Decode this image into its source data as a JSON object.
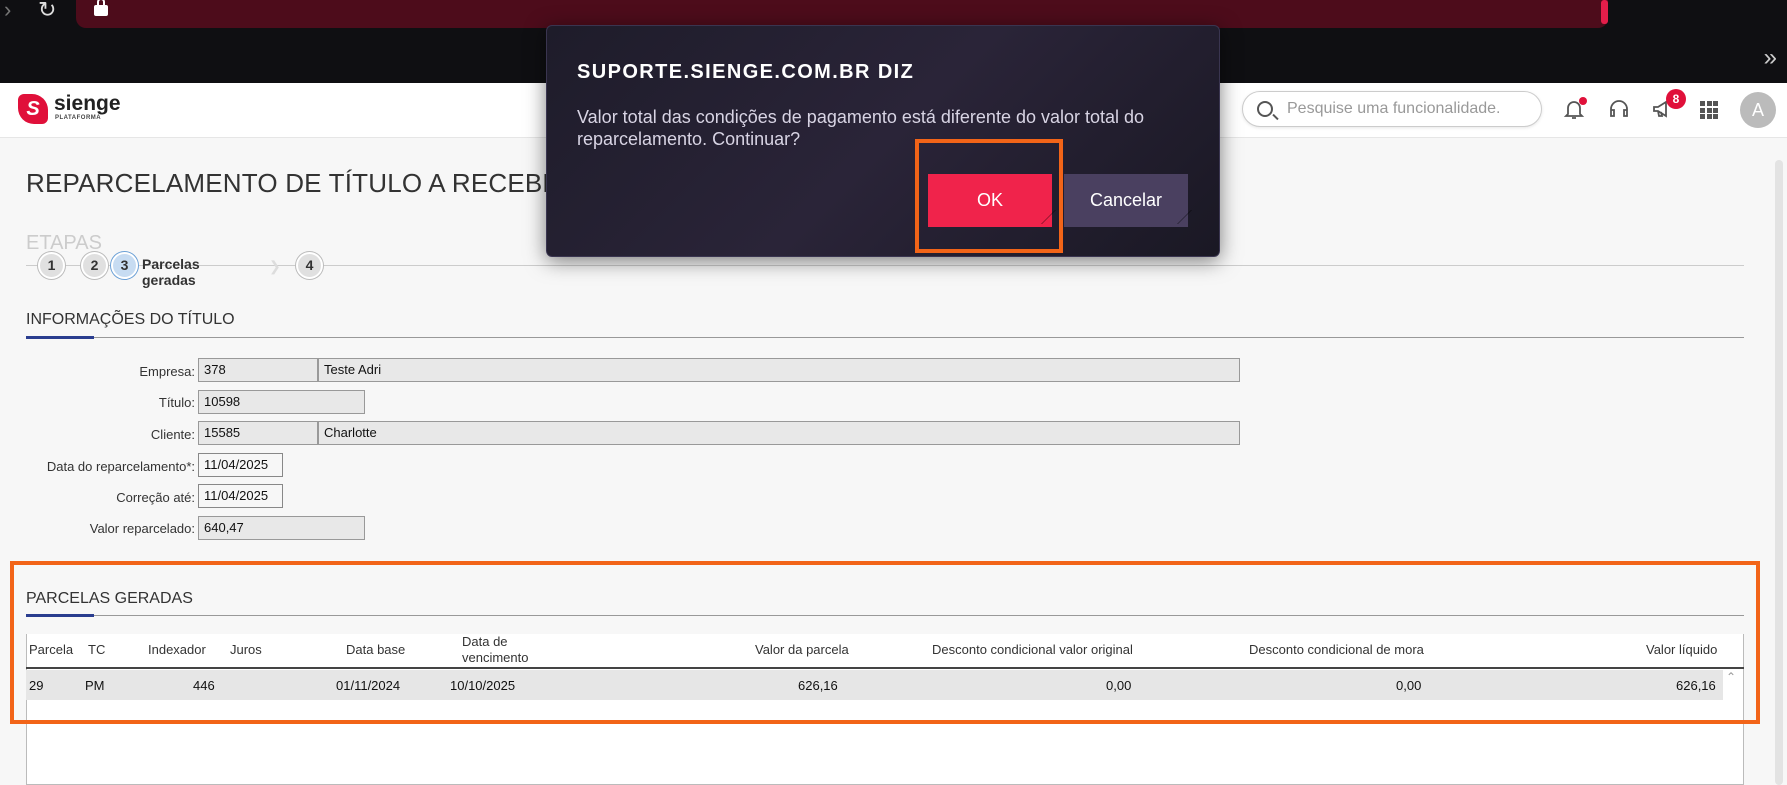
{
  "header": {
    "logo_text": "sienge",
    "logo_sub": "PLATAFORMA",
    "logo_letter": "S",
    "search_placeholder": "Pesquise uma funcionalidade.",
    "notification_badge": "8",
    "avatar_letter": "A"
  },
  "page": {
    "title": "REPARCELAMENTO DE TÍTULO A RECEBER",
    "etapas_label": "ETAPAS",
    "steps": [
      "1",
      "2",
      "3",
      "4"
    ],
    "active_step_label": "Parcelas geradas"
  },
  "info_section": {
    "title": "INFORMAÇÕES DO TÍTULO",
    "fields": {
      "empresa_label": "Empresa:",
      "empresa_code": "378",
      "empresa_name": "Teste Adri",
      "titulo_label": "Título:",
      "titulo_value": "10598",
      "cliente_label": "Cliente:",
      "cliente_code": "15585",
      "cliente_name": "Charlotte",
      "data_reparc_label": "Data do reparcelamento*:",
      "data_reparc_value": "11/04/2025",
      "correcao_label": "Correção até:",
      "correcao_value": "11/04/2025",
      "valor_label": "Valor reparcelado:",
      "valor_value": "640,47"
    }
  },
  "parcelas_section": {
    "title": "PARCELAS GERADAS",
    "columns": {
      "parcela": "Parcela",
      "tc": "TC",
      "indexador": "Indexador",
      "juros": "Juros",
      "data_base": "Data base",
      "data_venc_1": "Data de",
      "data_venc_2": "vencimento",
      "valor_parcela": "Valor da parcela",
      "desc_original": "Desconto condicional valor original",
      "desc_mora": "Desconto condicional de mora",
      "valor_liquido": "Valor líquido"
    },
    "rows": [
      {
        "parcela": "29",
        "tc": "PM",
        "indexador": "446",
        "juros": "",
        "data_base": "01/11/2024",
        "data_vencimento": "10/10/2025",
        "valor_parcela": "626,16",
        "desc_original": "0,00",
        "desc_mora": "0,00",
        "valor_liquido": "626,16"
      }
    ]
  },
  "dialog": {
    "title": "SUPORTE.SIENGE.COM.BR DIZ",
    "message": "Valor total das condições de pagamento está diferente do valor total do reparcelamento. Continuar?",
    "ok_label": "OK",
    "cancel_label": "Cancelar"
  },
  "colors": {
    "highlight": "#f26418",
    "brand": "#e0103a",
    "ok_button": "#f0234b"
  }
}
